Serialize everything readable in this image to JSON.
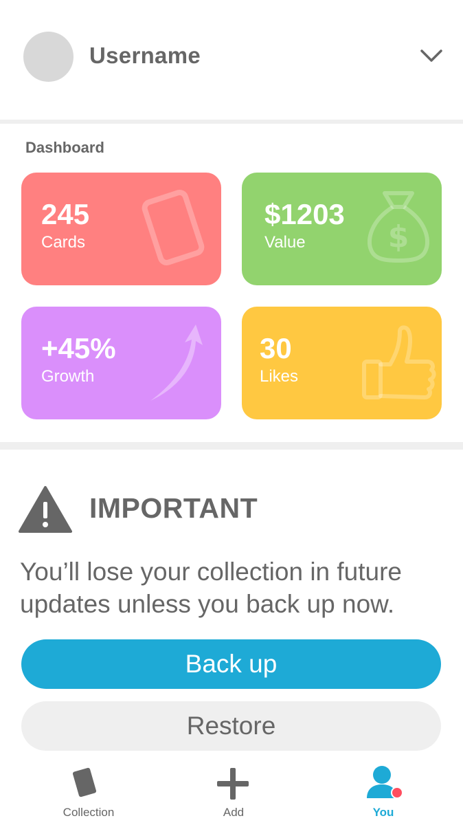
{
  "header": {
    "username": "Username"
  },
  "dashboard": {
    "label": "Dashboard",
    "cards": [
      {
        "value": "245",
        "label": "Cards",
        "color": "#ff8080",
        "icon": "card-icon"
      },
      {
        "value": "$1203",
        "label": "Value",
        "color": "#92d36e",
        "icon": "money-bag-icon"
      },
      {
        "value": "+45%",
        "label": "Growth",
        "color": "#da8ffb",
        "icon": "growth-arrow-icon"
      },
      {
        "value": "30",
        "label": "Likes",
        "color": "#ffc841",
        "icon": "thumbs-up-icon"
      }
    ]
  },
  "important": {
    "title": "IMPORTANT",
    "message": "You’ll lose your collection in future updates unless you back up now.",
    "backup_label": "Back up",
    "restore_label": "Restore"
  },
  "nav": {
    "items": [
      {
        "label": "Collection",
        "icon": "card-icon",
        "active": false
      },
      {
        "label": "Add",
        "icon": "plus-icon",
        "active": false
      },
      {
        "label": "You",
        "icon": "user-icon",
        "active": true,
        "badge": true
      }
    ]
  },
  "colors": {
    "accent": "#1eaad6",
    "text": "#666666",
    "badge": "#ff4d5e"
  }
}
